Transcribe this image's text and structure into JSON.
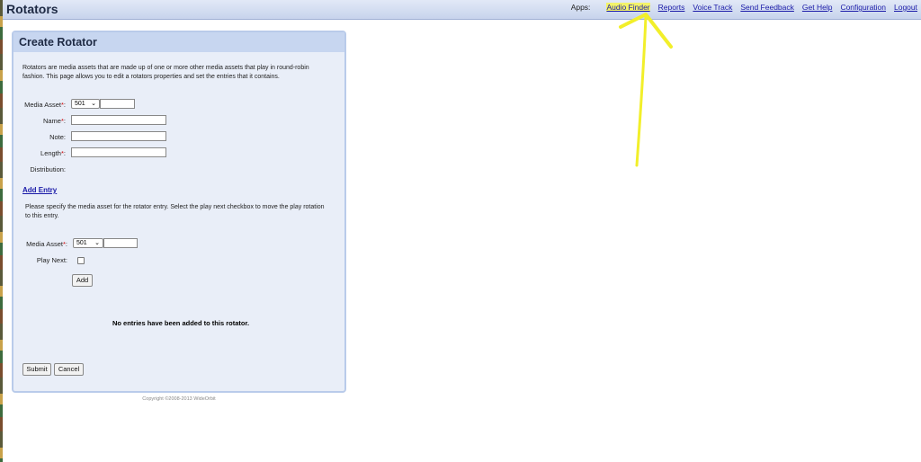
{
  "app": {
    "title": "Rotators"
  },
  "nav": {
    "apps_label": "Apps:",
    "links": [
      "Audio Finder",
      "Reports",
      "Voice Track",
      "Send Feedback",
      "Get Help",
      "Configuration",
      "Logout"
    ]
  },
  "panel": {
    "title": "Create Rotator",
    "intro": "Rotators are media assets that are made up of one or more other media assets that play in round-robin fashion. This page allows you to edit a rotators properties and set the entries that it contains.",
    "form": {
      "media_asset_label": "Media Asset",
      "media_asset_select": "501",
      "name_label": "Name",
      "note_label": "Note:",
      "length_label": "Length",
      "distribution_label": "Distribution:"
    },
    "add_entry_link": "Add Entry",
    "entry_help": "Please specify the media asset for the rotator entry. Select the play next checkbox to move the play rotation to this entry.",
    "entry_form": {
      "media_asset_label": "Media Asset",
      "media_asset_select": "501",
      "play_next_label": "Play Next:",
      "add_button": "Add"
    },
    "empty_message": "No entries have been added to this rotator.",
    "submit_button": "Submit",
    "cancel_button": "Cancel"
  },
  "footer": {
    "copyright": "Copyright ©2008-2013 WideOrbit"
  },
  "colors": {
    "annotation_arrow": "#f2ef2a",
    "link": "#1a1aa8",
    "highlight": "#f3f36a"
  }
}
